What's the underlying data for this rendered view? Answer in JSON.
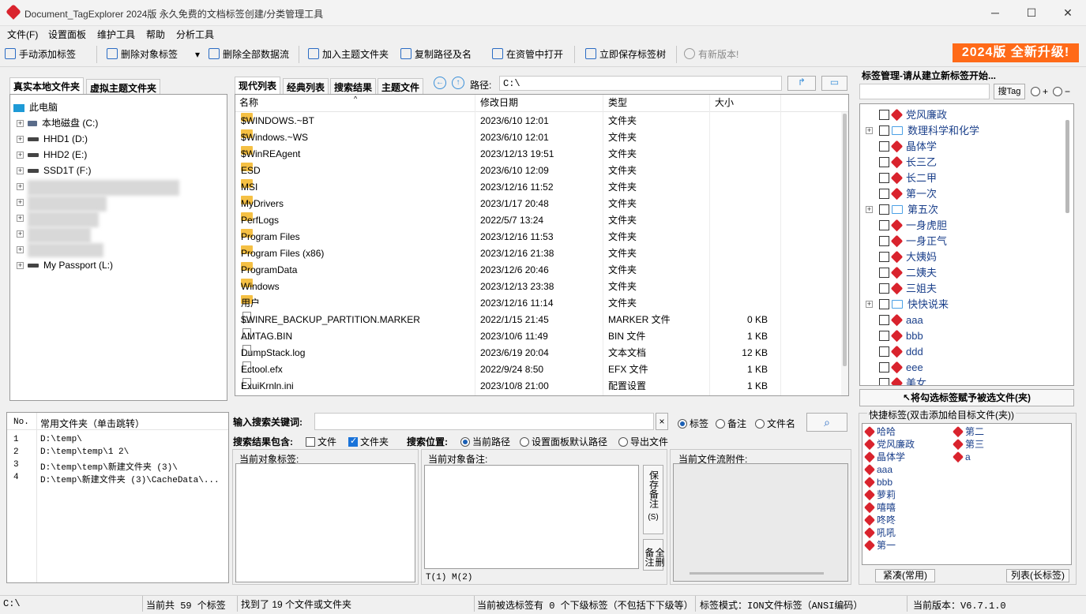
{
  "window": {
    "title": "Document_TagExplorer 2024版  永久免费的文档标签创建/分类管理工具",
    "minimize": "─",
    "maximize": "☐",
    "close": "✕"
  },
  "menu": [
    "文件(F)",
    "设置面板",
    "维护工具",
    "帮助",
    "分析工具"
  ],
  "toolbar": {
    "manual_add_tag": "手动添加标签",
    "delete_object_tag": "删除对象标签",
    "delete_all_streams": "删除全部数据流",
    "add_topic_folder": "加入主题文件夹",
    "copy_path": "复制路径及名",
    "open_in_explorer": "在资管中打开",
    "save_tag_tree": "立即保存标签树",
    "new_version": "有新版本!",
    "promo": "2024版 全新升级!"
  },
  "left_tabs": [
    "真实本地文件夹",
    "虚拟主题文件夹"
  ],
  "tree": {
    "root": "此电脑",
    "drives": [
      "本地磁盘 (C:)",
      "HHD1 (D:)",
      "HHD2 (E:)",
      "SSD1T (F:)",
      "My Passport (L:)"
    ]
  },
  "favorites": {
    "headers": [
      "No.",
      "常用文件夹（单击跳转）"
    ],
    "rows": [
      {
        "no": "1",
        "path": "D:\\temp\\"
      },
      {
        "no": "2",
        "path": "D:\\temp\\temp\\1  2\\"
      },
      {
        "no": "3",
        "path": "D:\\temp\\temp\\新建文件夹 (3)\\"
      },
      {
        "no": "4",
        "path": "D:\\temp\\新建文件夹 (3)\\CacheData\\..."
      }
    ]
  },
  "center_tabs": [
    "现代列表",
    "经典列表",
    "搜索结果",
    "主题文件"
  ],
  "path_label": "路径:",
  "path_value": "C:\\",
  "file_list": {
    "headers": [
      "名称",
      "修改日期",
      "类型",
      "大小"
    ],
    "rows": [
      {
        "name": "$WINDOWS.~BT",
        "date": "2023/6/10 12:01",
        "type": "文件夹",
        "size": "",
        "kind": "folder"
      },
      {
        "name": "$Windows.~WS",
        "date": "2023/6/10 12:01",
        "type": "文件夹",
        "size": "",
        "kind": "folder"
      },
      {
        "name": "$WinREAgent",
        "date": "2023/12/13 19:51",
        "type": "文件夹",
        "size": "",
        "kind": "folder"
      },
      {
        "name": "ESD",
        "date": "2023/6/10 12:09",
        "type": "文件夹",
        "size": "",
        "kind": "folder"
      },
      {
        "name": "MSI",
        "date": "2023/12/16 11:52",
        "type": "文件夹",
        "size": "",
        "kind": "folder"
      },
      {
        "name": "MyDrivers",
        "date": "2023/1/17 20:48",
        "type": "文件夹",
        "size": "",
        "kind": "folder"
      },
      {
        "name": "PerfLogs",
        "date": "2022/5/7 13:24",
        "type": "文件夹",
        "size": "",
        "kind": "folder"
      },
      {
        "name": "Program Files",
        "date": "2023/12/16 11:53",
        "type": "文件夹",
        "size": "",
        "kind": "folder"
      },
      {
        "name": "Program Files (x86)",
        "date": "2023/12/16 21:38",
        "type": "文件夹",
        "size": "",
        "kind": "folder"
      },
      {
        "name": "ProgramData",
        "date": "2023/12/6 20:46",
        "type": "文件夹",
        "size": "",
        "kind": "folder"
      },
      {
        "name": "Windows",
        "date": "2023/12/13 23:38",
        "type": "文件夹",
        "size": "",
        "kind": "folder"
      },
      {
        "name": "用户",
        "date": "2023/12/16 11:14",
        "type": "文件夹",
        "size": "",
        "kind": "folder"
      },
      {
        "name": "$WINRE_BACKUP_PARTITION.MARKER",
        "date": "2022/1/15 21:45",
        "type": "MARKER 文件",
        "size": "0 KB",
        "kind": "file"
      },
      {
        "name": "AMTAG.BIN",
        "date": "2023/10/6 11:49",
        "type": "BIN 文件",
        "size": "1 KB",
        "kind": "file"
      },
      {
        "name": "DumpStack.log",
        "date": "2023/6/19 20:04",
        "type": "文本文档",
        "size": "12 KB",
        "kind": "file"
      },
      {
        "name": "Ectool.efx",
        "date": "2022/9/24 8:50",
        "type": "EFX 文件",
        "size": "1 KB",
        "kind": "file"
      },
      {
        "name": "ExuiKrnln.ini",
        "date": "2023/10/8 21:00",
        "type": "配置设置",
        "size": "1 KB",
        "kind": "file"
      }
    ]
  },
  "search": {
    "keyword_label": "输入搜索关键词:",
    "clear": "×",
    "mode_options": [
      "标签",
      "备注",
      "文件名"
    ],
    "include_label": "搜索结果包含:",
    "include_file": "文件",
    "include_folder": "文件夹",
    "location_label": "搜索位置:",
    "location_options": [
      "当前路径",
      "设置面板默认路径",
      "导出文件"
    ]
  },
  "bottom_panels": {
    "tags_label": "当前对象标签:",
    "notes_label": "当前对象备注:",
    "streams_label": "当前文件流附件:",
    "save_note": "保存备注",
    "save_note_key": "(S)",
    "delete_all_notes": "全删备注",
    "t_label": "T(1)",
    "m_label": "M(2)"
  },
  "tag_manager": {
    "title": "标签管理-请从建立新标签开始...",
    "search_button": "搜Tag",
    "plus": "+",
    "minus": "−",
    "tags": [
      {
        "label": "党风廉政",
        "kind": "tag",
        "exp": false
      },
      {
        "label": "数理科学和化学",
        "kind": "folder",
        "exp": true
      },
      {
        "label": "晶体学",
        "kind": "tag",
        "exp": false
      },
      {
        "label": "长三乙",
        "kind": "tag",
        "exp": false
      },
      {
        "label": "长二甲",
        "kind": "tag",
        "exp": false
      },
      {
        "label": "第一次",
        "kind": "tag",
        "exp": false
      },
      {
        "label": "第五次",
        "kind": "folder",
        "exp": true
      },
      {
        "label": "一身虎胆",
        "kind": "tag",
        "exp": false
      },
      {
        "label": "一身正气",
        "kind": "tag",
        "exp": false
      },
      {
        "label": "大姨妈",
        "kind": "tag",
        "exp": false
      },
      {
        "label": "二姨夫",
        "kind": "tag",
        "exp": false
      },
      {
        "label": "三姐夫",
        "kind": "tag",
        "exp": false
      },
      {
        "label": "快快说来",
        "kind": "folder",
        "exp": true
      },
      {
        "label": "aaa",
        "kind": "tag",
        "exp": false
      },
      {
        "label": "bbb",
        "kind": "tag",
        "exp": false
      },
      {
        "label": "ddd",
        "kind": "tag",
        "exp": false
      },
      {
        "label": "eee",
        "kind": "tag",
        "exp": false
      },
      {
        "label": "美女",
        "kind": "tag",
        "exp": false
      }
    ],
    "assign_button": "↖将勾选标签赋予被选文件(夹)"
  },
  "quick_tags": {
    "title": "快捷标签(双击添加给目标文件(夹))",
    "col1": [
      "哈哈",
      "党风廉政",
      "晶体学",
      "aaa",
      "bbb",
      "萝莉",
      "嘻嘻",
      "咚咚",
      "吼吼",
      "第一"
    ],
    "col2": [
      "第二",
      "第三",
      "a"
    ],
    "compact_btn": "紧凑(常用)",
    "list_btn": "列表(长标签)"
  },
  "status": {
    "path": "C:\\",
    "tag_count": "当前共 59 个标签",
    "found": "找到了 19 个文件或文件夹",
    "sub_tags": "当前被选标签有 0 个下级标签（不包括下下级等）",
    "tag_mode": "标签模式：ION文件标签（ANSI编码）",
    "version": "当前版本：V6.7.1.0"
  }
}
